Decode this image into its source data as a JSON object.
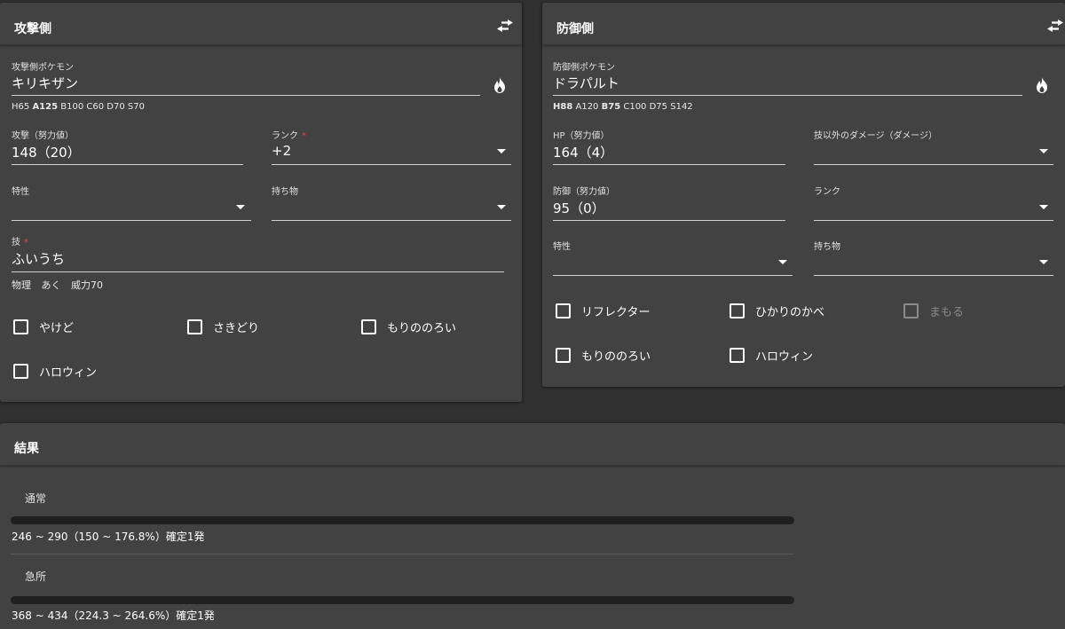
{
  "attacker": {
    "title": "攻撃側",
    "pokemon_label": "攻撃側ポケモン",
    "pokemon": "キリキザン",
    "stats": [
      {
        "text": "H65",
        "bold": false
      },
      {
        "text": "A125",
        "bold": true
      },
      {
        "text": "B100",
        "bold": false
      },
      {
        "text": "C60",
        "bold": false
      },
      {
        "text": "D70",
        "bold": false
      },
      {
        "text": "S70",
        "bold": false
      }
    ],
    "attack_label": "攻撃（努力値）",
    "attack_value": "148（20）",
    "rank_label": "ランク",
    "rank_value": "+2",
    "ability_label": "特性",
    "ability_value": "",
    "item_label": "持ち物",
    "item_value": "",
    "move_label": "技",
    "move_value": "ふいうち",
    "move_category": "物理",
    "move_type": "あく",
    "move_power": "威力70",
    "checkboxes": [
      {
        "label": "やけど",
        "checked": false,
        "disabled": false
      },
      {
        "label": "さきどり",
        "checked": false,
        "disabled": false
      },
      {
        "label": "もりののろい",
        "checked": false,
        "disabled": false
      },
      {
        "label": "ハロウィン",
        "checked": false,
        "disabled": false
      }
    ]
  },
  "defender": {
    "title": "防御側",
    "pokemon_label": "防御側ポケモン",
    "pokemon": "ドラパルト",
    "stats": [
      {
        "text": "H88",
        "bold": true
      },
      {
        "text": "A120",
        "bold": false
      },
      {
        "text": "B75",
        "bold": true
      },
      {
        "text": "C100",
        "bold": false
      },
      {
        "text": "D75",
        "bold": false
      },
      {
        "text": "S142",
        "bold": false
      }
    ],
    "hp_label": "HP（努力値）",
    "hp_value": "164（4）",
    "other_damage_label": "技以外のダメージ（ダメージ）",
    "other_damage_value": "",
    "defense_label": "防御（努力値）",
    "defense_value": "95（0）",
    "rank_label": "ランク",
    "rank_value": "",
    "ability_label": "特性",
    "ability_value": "",
    "item_label": "持ち物",
    "item_value": "",
    "checkboxes": [
      {
        "label": "リフレクター",
        "checked": false,
        "disabled": false
      },
      {
        "label": "ひかりのかべ",
        "checked": false,
        "disabled": false
      },
      {
        "label": "まもる",
        "checked": false,
        "disabled": true
      },
      {
        "label": "もりののろい",
        "checked": false,
        "disabled": false
      },
      {
        "label": "ハロウィン",
        "checked": false,
        "disabled": false
      }
    ]
  },
  "result": {
    "title": "結果",
    "normal_label": "通常",
    "normal_text": "246 ~ 290（150 ~ 176.8%）確定1発",
    "critical_label": "急所",
    "critical_text": "368 ~ 434（224.3 ~ 264.6%）確定1発"
  }
}
